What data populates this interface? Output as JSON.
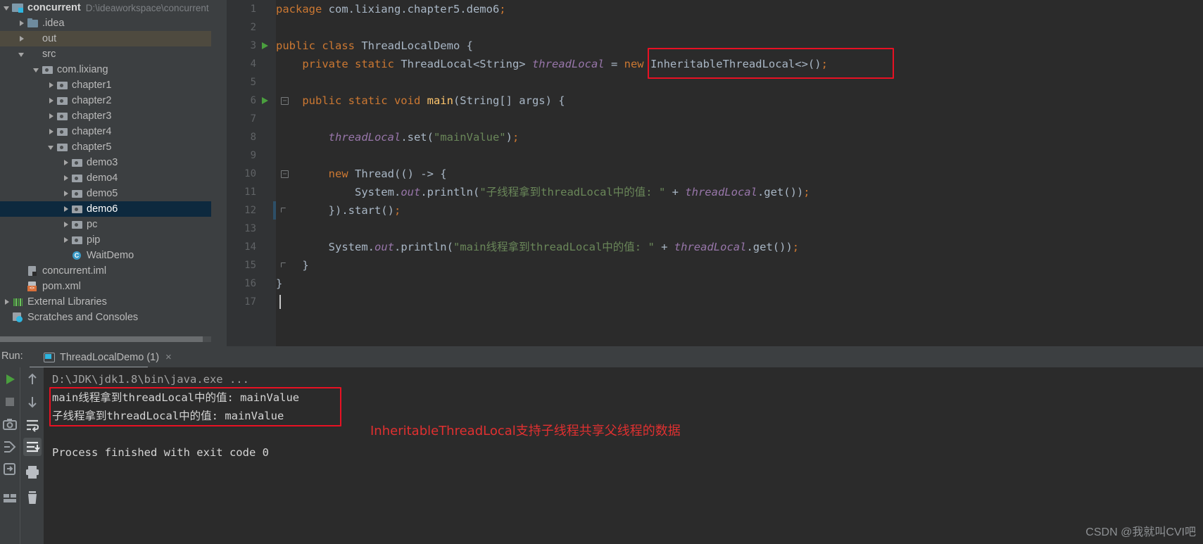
{
  "project": {
    "root": {
      "label": "concurrent",
      "path": "D:\\ideaworkspace\\concurrent",
      "icon": "module-project-icon"
    },
    "items": [
      {
        "label": ".idea",
        "icon": "folder-icon",
        "indent": 1,
        "arrow": "closed",
        "state": "normal"
      },
      {
        "label": "out",
        "icon": "folder-orange-icon",
        "indent": 1,
        "arrow": "closed",
        "state": "excluded"
      },
      {
        "label": "src",
        "icon": "folder-blue-icon",
        "indent": 1,
        "arrow": "open",
        "state": "normal"
      },
      {
        "label": "com.lixiang",
        "icon": "package-icon",
        "indent": 2,
        "arrow": "open",
        "state": "normal"
      },
      {
        "label": "chapter1",
        "icon": "package-icon",
        "indent": 3,
        "arrow": "closed",
        "state": "normal"
      },
      {
        "label": "chapter2",
        "icon": "package-icon",
        "indent": 3,
        "arrow": "closed",
        "state": "normal"
      },
      {
        "label": "chapter3",
        "icon": "package-icon",
        "indent": 3,
        "arrow": "closed",
        "state": "normal"
      },
      {
        "label": "chapter4",
        "icon": "package-icon",
        "indent": 3,
        "arrow": "closed",
        "state": "normal"
      },
      {
        "label": "chapter5",
        "icon": "package-icon",
        "indent": 3,
        "arrow": "open",
        "state": "normal"
      },
      {
        "label": "demo3",
        "icon": "package-icon",
        "indent": 4,
        "arrow": "closed",
        "state": "normal"
      },
      {
        "label": "demo4",
        "icon": "package-icon",
        "indent": 4,
        "arrow": "closed",
        "state": "normal"
      },
      {
        "label": "demo5",
        "icon": "package-icon",
        "indent": 4,
        "arrow": "closed",
        "state": "normal"
      },
      {
        "label": "demo6",
        "icon": "package-icon",
        "indent": 4,
        "arrow": "closed",
        "state": "selected"
      },
      {
        "label": "pc",
        "icon": "package-icon",
        "indent": 4,
        "arrow": "closed",
        "state": "normal"
      },
      {
        "label": "pip",
        "icon": "package-icon",
        "indent": 4,
        "arrow": "closed",
        "state": "normal"
      },
      {
        "label": "WaitDemo",
        "icon": "java-class-icon",
        "indent": 4,
        "arrow": "none",
        "state": "normal"
      },
      {
        "label": "concurrent.iml",
        "icon": "module-file-icon",
        "indent": 1,
        "arrow": "none",
        "state": "normal"
      },
      {
        "label": "pom.xml",
        "icon": "xml-file-icon",
        "indent": 1,
        "arrow": "none",
        "state": "normal"
      },
      {
        "label": "External Libraries",
        "icon": "libraries-icon",
        "indent": 0,
        "arrow": "closed",
        "state": "normal"
      },
      {
        "label": "Scratches and Consoles",
        "icon": "scratches-icon",
        "indent": 0,
        "arrow": "none",
        "state": "normal"
      }
    ]
  },
  "editor": {
    "lines": [
      {
        "n": "1",
        "runnable": false,
        "fold": "",
        "tokens": [
          {
            "t": "package ",
            "c": "kw"
          },
          {
            "t": "com.lixiang.chapter5.demo6",
            "c": "plain"
          },
          {
            "t": ";",
            "c": "sem"
          }
        ]
      },
      {
        "n": "2",
        "runnable": false,
        "fold": "",
        "tokens": []
      },
      {
        "n": "3",
        "runnable": true,
        "fold": "",
        "tokens": [
          {
            "t": "public class ",
            "c": "kw"
          },
          {
            "t": "ThreadLocalDemo",
            "c": "plain"
          },
          {
            "t": " {",
            "c": "plain"
          }
        ]
      },
      {
        "n": "4",
        "runnable": false,
        "fold": "",
        "tokens": [
          {
            "t": "    private static ",
            "c": "kw"
          },
          {
            "t": "ThreadLocal<String> ",
            "c": "plain"
          },
          {
            "t": "threadLocal",
            "c": "fld"
          },
          {
            "t": " = ",
            "c": "plain"
          },
          {
            "t": "new ",
            "c": "kw"
          },
          {
            "t": "InheritableThreadLocal<>()",
            "c": "plain"
          },
          {
            "t": ";",
            "c": "sem"
          }
        ]
      },
      {
        "n": "5",
        "runnable": false,
        "fold": "",
        "tokens": []
      },
      {
        "n": "6",
        "runnable": true,
        "fold": "start",
        "tokens": [
          {
            "t": "    public static void ",
            "c": "kw"
          },
          {
            "t": "main",
            "c": "meth"
          },
          {
            "t": "(String[] args) {",
            "c": "plain"
          }
        ]
      },
      {
        "n": "7",
        "runnable": false,
        "fold": "",
        "tokens": []
      },
      {
        "n": "8",
        "runnable": false,
        "fold": "",
        "tokens": [
          {
            "t": "        ",
            "c": "plain"
          },
          {
            "t": "threadLocal",
            "c": "fld"
          },
          {
            "t": ".set(",
            "c": "plain"
          },
          {
            "t": "\"mainValue\"",
            "c": "str"
          },
          {
            "t": ")",
            "c": "plain"
          },
          {
            "t": ";",
            "c": "sem"
          }
        ]
      },
      {
        "n": "9",
        "runnable": false,
        "fold": "",
        "tokens": []
      },
      {
        "n": "10",
        "runnable": false,
        "fold": "start",
        "tokens": [
          {
            "t": "        ",
            "c": "plain"
          },
          {
            "t": "new ",
            "c": "kw"
          },
          {
            "t": "Thread(() -> {",
            "c": "plain"
          }
        ]
      },
      {
        "n": "11",
        "runnable": false,
        "fold": "",
        "tokens": [
          {
            "t": "            System.",
            "c": "plain"
          },
          {
            "t": "out",
            "c": "stat"
          },
          {
            "t": ".println(",
            "c": "plain"
          },
          {
            "t": "\"子线程拿到threadLocal中的值: \"",
            "c": "str"
          },
          {
            "t": " + ",
            "c": "plain"
          },
          {
            "t": "threadLocal",
            "c": "fld"
          },
          {
            "t": ".get())",
            "c": "plain"
          },
          {
            "t": ";",
            "c": "sem"
          }
        ]
      },
      {
        "n": "12",
        "runnable": false,
        "fold": "end",
        "tokens": [
          {
            "t": "        }).start()",
            "c": "plain"
          },
          {
            "t": ";",
            "c": "sem"
          }
        ]
      },
      {
        "n": "13",
        "runnable": false,
        "fold": "",
        "tokens": []
      },
      {
        "n": "14",
        "runnable": false,
        "fold": "",
        "tokens": [
          {
            "t": "        System.",
            "c": "plain"
          },
          {
            "t": "out",
            "c": "stat"
          },
          {
            "t": ".println(",
            "c": "plain"
          },
          {
            "t": "\"main线程拿到threadLocal中的值: \"",
            "c": "str"
          },
          {
            "t": " + ",
            "c": "plain"
          },
          {
            "t": "threadLocal",
            "c": "fld"
          },
          {
            "t": ".get())",
            "c": "plain"
          },
          {
            "t": ";",
            "c": "sem"
          }
        ]
      },
      {
        "n": "15",
        "runnable": false,
        "fold": "end",
        "tokens": [
          {
            "t": "    }",
            "c": "plain"
          }
        ]
      },
      {
        "n": "16",
        "runnable": false,
        "fold": "",
        "tokens": [
          {
            "t": "}",
            "c": "plain"
          }
        ]
      },
      {
        "n": "17",
        "runnable": false,
        "fold": "",
        "tokens": []
      }
    ],
    "highlight_color": "#e81123"
  },
  "run_panel": {
    "run_label": "Run:",
    "tab_title": "ThreadLocalDemo (1)",
    "close_glyph": "×",
    "console": {
      "command_line": "D:\\JDK\\jdk1.8\\bin\\java.exe ...",
      "output": [
        "main线程拿到threadLocal中的值: mainValue",
        "子线程拿到threadLocal中的值: mainValue"
      ],
      "exit_line": "Process finished with exit code 0"
    },
    "annotation": "InheritableThreadLocal支持子线程共享父线程的数据",
    "annotation_color": "#e03030"
  },
  "watermark": "CSDN @我就叫CVI吧"
}
